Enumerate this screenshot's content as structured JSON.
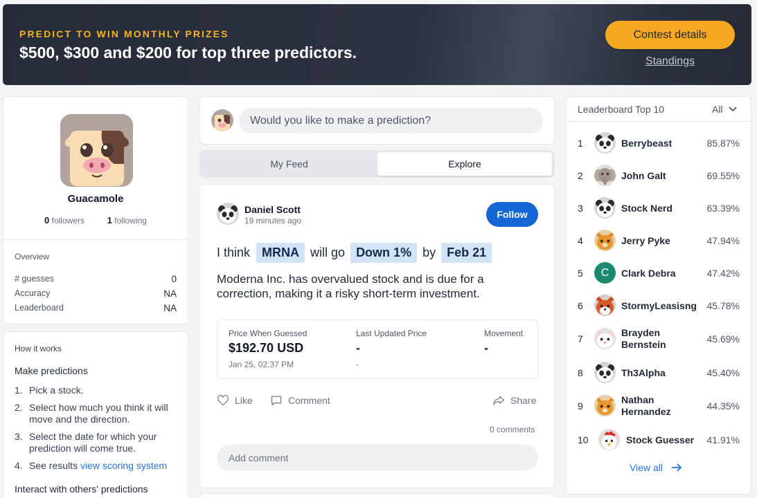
{
  "banner": {
    "eyebrow": "PREDICT TO WIN MONTHLY PRIZES",
    "headline": "$500, $300 and $200 for top three predictors.",
    "contest_button": "Contest details",
    "standings_link": "Standings"
  },
  "profile": {
    "name": "Guacamole",
    "followers_count": "0",
    "followers_label": "followers",
    "following_count": "1",
    "following_label": "following",
    "overview_title": "Overview",
    "stats": [
      {
        "label": "# guesses",
        "value": "0"
      },
      {
        "label": "Accuracy",
        "value": "NA"
      },
      {
        "label": "Leaderboard",
        "value": "NA"
      }
    ]
  },
  "how_it_works": {
    "title": "How it works",
    "section1": "Make predictions",
    "steps": [
      {
        "num": "1.",
        "text": "Pick a stock."
      },
      {
        "num": "2.",
        "text": "Select how much you think it will move and the direction."
      },
      {
        "num": "3.",
        "text": "Select the date for which your prediction will come true."
      },
      {
        "num": "4.",
        "text": "See results ",
        "link": "view scoring system"
      }
    ],
    "section2": "Interact with others' predictions"
  },
  "composer": {
    "placeholder": "Would you like to make a prediction?"
  },
  "tabs": [
    {
      "label": "My Feed",
      "active": false
    },
    {
      "label": "Explore",
      "active": true
    }
  ],
  "post": {
    "author": "Daniel Scott",
    "time": "19 minutes ago",
    "follow_label": "Follow",
    "prediction": {
      "w1": "I think",
      "ticker": "MRNA",
      "w2": "will go",
      "move": "Down 1%",
      "w3": "by",
      "date": "Feb 21"
    },
    "body": "Moderna Inc. has overvalued stock and is due for a correction, making it a risky short-term investment.",
    "price": {
      "guessed_label": "Price When Guessed",
      "guessed_value": "$192.70 USD",
      "guessed_date": "Jan 25, 02:37 PM",
      "updated_label": "Last Updated Price",
      "updated_value": "-",
      "updated_sub": "-",
      "movement_label": "Movement",
      "movement_value": "-"
    },
    "like_label": "Like",
    "comment_label": "Comment",
    "share_label": "Share",
    "comment_count": "0 comments",
    "add_comment_placeholder": "Add comment"
  },
  "leaderboard": {
    "title": "Leaderboard Top 10",
    "filter": "All",
    "view_all": "View all",
    "entries": [
      {
        "rank": "1",
        "name": "Berrybeast",
        "pct": "85.87%",
        "avatar": "panda-avatar"
      },
      {
        "rank": "2",
        "name": "John Galt",
        "pct": "69.55%",
        "avatar": "elephant-avatar"
      },
      {
        "rank": "3",
        "name": "Stock Nerd",
        "pct": "63.39%",
        "avatar": "panda-avatar"
      },
      {
        "rank": "4",
        "name": "Jerry Pyke",
        "pct": "47.94%",
        "avatar": "cat-avatar"
      },
      {
        "rank": "5",
        "name": "Clark Debra",
        "pct": "47.42%",
        "avatar": "initial-avatar",
        "initial": "C"
      },
      {
        "rank": "6",
        "name": "StormyLeasisng",
        "pct": "45.78%",
        "avatar": "fox-avatar"
      },
      {
        "rank": "7",
        "name": "Brayden Bernstein",
        "pct": "45.69%",
        "avatar": "cat-white-avatar"
      },
      {
        "rank": "8",
        "name": "Th3Alpha",
        "pct": "45.40%",
        "avatar": "panda-avatar"
      },
      {
        "rank": "9",
        "name": "Nathan Hernandez",
        "pct": "44.35%",
        "avatar": "cat-avatar"
      },
      {
        "rank": "10",
        "name": "Stock Guesser",
        "pct": "41.91%",
        "avatar": "rooster-avatar"
      }
    ]
  },
  "colors": {
    "accent_orange": "#f6a823",
    "primary_blue": "#1667d6",
    "chip_blue": "#d2e3f7",
    "initial_avatar_green": "#1a8a6e"
  }
}
